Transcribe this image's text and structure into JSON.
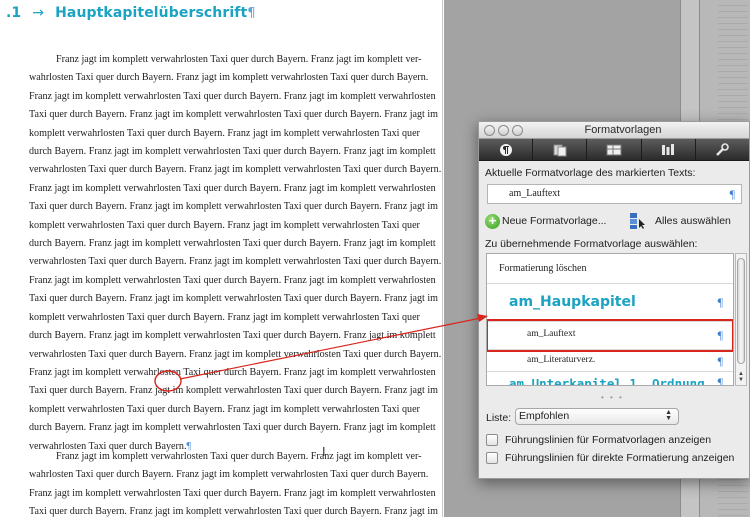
{
  "document": {
    "heading": {
      "number": ".1",
      "arrow": "→",
      "title": "Hauptkapitelüberschrift",
      "pilcrow": "¶"
    },
    "paragraph1_lines": [
      "Franz jagt im komplett verwahrlosten Taxi quer durch Bayern. Franz jagt im komplett ver-",
      "wahrlosten Taxi quer durch Bayern. Franz jagt im komplett verwahrlosten Taxi quer durch Bayern.",
      "Franz jagt im komplett verwahrlosten Taxi quer durch Bayern. Franz jagt im komplett verwahrlosten",
      "Taxi quer durch Bayern. Franz jagt im komplett verwahrlosten Taxi quer durch Bayern. Franz jagt im",
      "komplett verwahrlosten Taxi quer durch Bayern. Franz jagt im komplett verwahrlosten Taxi quer",
      "durch Bayern. Franz jagt im komplett verwahrlosten Taxi quer durch Bayern. Franz jagt im komplett",
      "verwahrlosten Taxi quer durch Bayern. Franz jagt im komplett verwahrlosten Taxi quer durch Bayern.",
      "Franz jagt im komplett verwahrlosten Taxi quer durch Bayern. Franz jagt im komplett verwahrlosten",
      "Taxi quer durch Bayern. Franz jagt im komplett verwahrlosten Taxi quer durch Bayern. Franz jagt im",
      "komplett verwahrlosten Taxi quer durch Bayern. Franz jagt im komplett verwahrlosten Taxi quer",
      "durch Bayern. Franz jagt im komplett verwahrlosten Taxi quer durch Bayern. Franz jagt im komplett",
      "verwahrlosten Taxi quer durch Bayern. Franz jagt im komplett verwahrlosten Taxi quer durch Bayern.",
      "Franz jagt im komplett verwahrlosten Taxi quer durch Bayern. Franz jagt im komplett verwahrlosten",
      "Taxi quer durch Bayern. Franz jagt im komplett verwahrlosten Taxi quer durch Bayern. Franz jagt im",
      "komplett verwahrlosten Taxi quer durch Bayern. Franz jagt im komplett verwahrlosten Taxi quer",
      "durch Bayern. Franz jagt im komplett verwahrlosten Taxi quer durch Bayern. Franz jagt im komplett",
      "verwahrlosten Taxi quer durch Bayern. Franz jagt im komplett verwahrlosten Taxi quer durch Bayern.",
      "Franz jagt im komplett verwahrlosten Taxi quer durch Bayern. Franz jagt im komplett verwahrlosten",
      "Taxi quer durch Bayern. Franz jagt im komplett verwahrlosten Taxi quer durch Bayern. Franz jagt im",
      "komplett verwahrlosten Taxi quer durch Bayern. Franz jagt im komplett verwahrlosten Taxi quer",
      "durch Bayern. Franz jagt im komplett verwahrlosten Taxi quer durch Bayern. Franz jagt im komplett",
      "verwahrlosten Taxi quer durch Bayern."
    ],
    "paragraph_mark": "¶",
    "paragraph2_lines": [
      "Franz jagt im komplett verwahrlosten Taxi quer durch Bayern. Franz jagt im komplett ver-",
      "wahrlosten Taxi quer durch Bayern. Franz jagt im komplett verwahrlosten Taxi quer durch Bayern.",
      "Franz jagt im komplett verwahrlosten Taxi quer durch Bayern. Franz jagt im komplett verwahrlosten",
      "Taxi quer durch Bayern. Franz jagt im komplett verwahrlosten Taxi quer durch Bayern. Franz jagt im"
    ]
  },
  "panel": {
    "title": "Formatvorlagen",
    "toolbar_icons": [
      "paragraph-style-icon",
      "character-style-icon",
      "table-style-icon",
      "list-style-icon",
      "wrench-icon"
    ],
    "current_style_label": "Aktuelle Formatvorlage des markierten Texts:",
    "current_style_value": "am_Lauftext",
    "new_style_label": "Neue Formatvorlage...",
    "select_all_label": "Alles auswählen",
    "apply_label": "Zu übernehmende Formatvorlage auswählen:",
    "styles": [
      {
        "name": "Formatierung löschen",
        "mark": ""
      },
      {
        "name": "am_Haupkapitel",
        "mark": "¶"
      },
      {
        "name": "am_Lauftext",
        "mark": "¶"
      },
      {
        "name": "am_Literaturverz.",
        "mark": "¶"
      },
      {
        "name": "am_Unterkapitel 1. Ordnung",
        "mark": "¶"
      }
    ],
    "pilcrow": "¶",
    "list_label": "Liste:",
    "list_value": "Empfohlen",
    "checkbox1_label": "Führungslinien für Formatvorlagen anzeigen",
    "checkbox2_label": "Führungslinien für direkte Formatierung anzeigen"
  },
  "colors": {
    "heading": "#1aa3c2",
    "annotation": "#d8261c",
    "pilcrow": "#3d7fd1"
  }
}
